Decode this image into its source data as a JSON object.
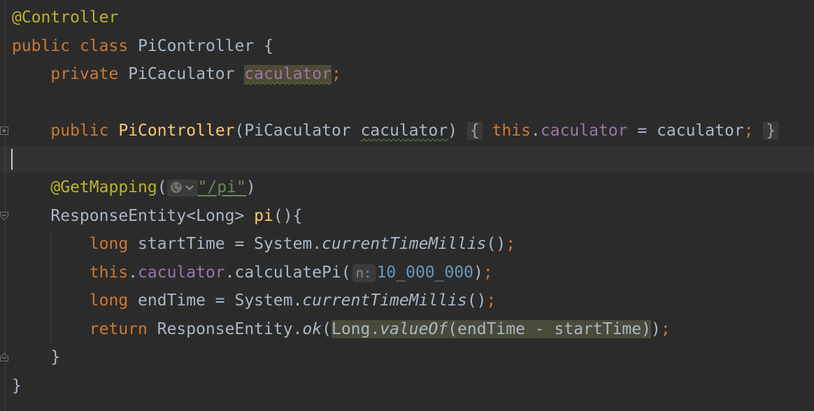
{
  "editor": {
    "language": "Java",
    "lines": {
      "l1": {
        "ann": "@Controller"
      },
      "l2": {
        "kw1": "public",
        "kw2": "class",
        "name": "PiController",
        "brace": "{"
      },
      "l3": {
        "kw": "private",
        "type": "PiCaculator",
        "field": "caculator",
        "semi": ";"
      },
      "l5": {
        "kw": "public",
        "ctor": "PiController",
        "paren_open": "(",
        "ptype": "PiCaculator",
        "param": "caculator",
        "paren_close": ")",
        "fold_open": "{",
        "this": "this",
        "dot": ".",
        "field": "caculator",
        "assign": " = ",
        "rhs": "caculator",
        "semi": ";",
        "fold_close": "}"
      },
      "l7": {
        "ann": "@GetMapping",
        "paren_open": "(",
        "str": "\"/pi\"",
        "paren_close": ")"
      },
      "l8": {
        "type": "ResponseEntity<Long>",
        "method": "pi",
        "tail": "(){"
      },
      "l9": {
        "kw": "long",
        "decl": " startTime = System.",
        "call": "currentTimeMillis",
        "tail": "()",
        "semi": ";"
      },
      "l10": {
        "this": "this",
        "dot": ".",
        "field": "caculator",
        "call": ".calculatePi(",
        "hint": "n:",
        "num": "10_000_000",
        "tail": ")",
        "semi": ";"
      },
      "l11": {
        "kw": "long",
        "decl": " endTime = System.",
        "call": "currentTimeMillis",
        "tail": "()",
        "semi": ";"
      },
      "l12": {
        "kw": "return",
        "pre": " ResponseEntity.",
        "ok": "ok",
        "paren_open": "(",
        "long": "Long.",
        "valueOf": "valueOf",
        "args": "(endTime - startTime)",
        "tail": ")",
        "semi": ";"
      },
      "l13": {
        "brace": "}"
      },
      "l14": {
        "brace": "}"
      }
    },
    "colors": {
      "background": "#2b2b2b",
      "keyword": "#cc7832",
      "annotation": "#bbb529",
      "method": "#ffc66d",
      "field": "#9876aa",
      "string": "#6a8759",
      "number": "#6897bb",
      "text": "#a9b7c6"
    },
    "icons": [
      "fold-icon",
      "globe-icon",
      "chevron-down-icon"
    ]
  }
}
